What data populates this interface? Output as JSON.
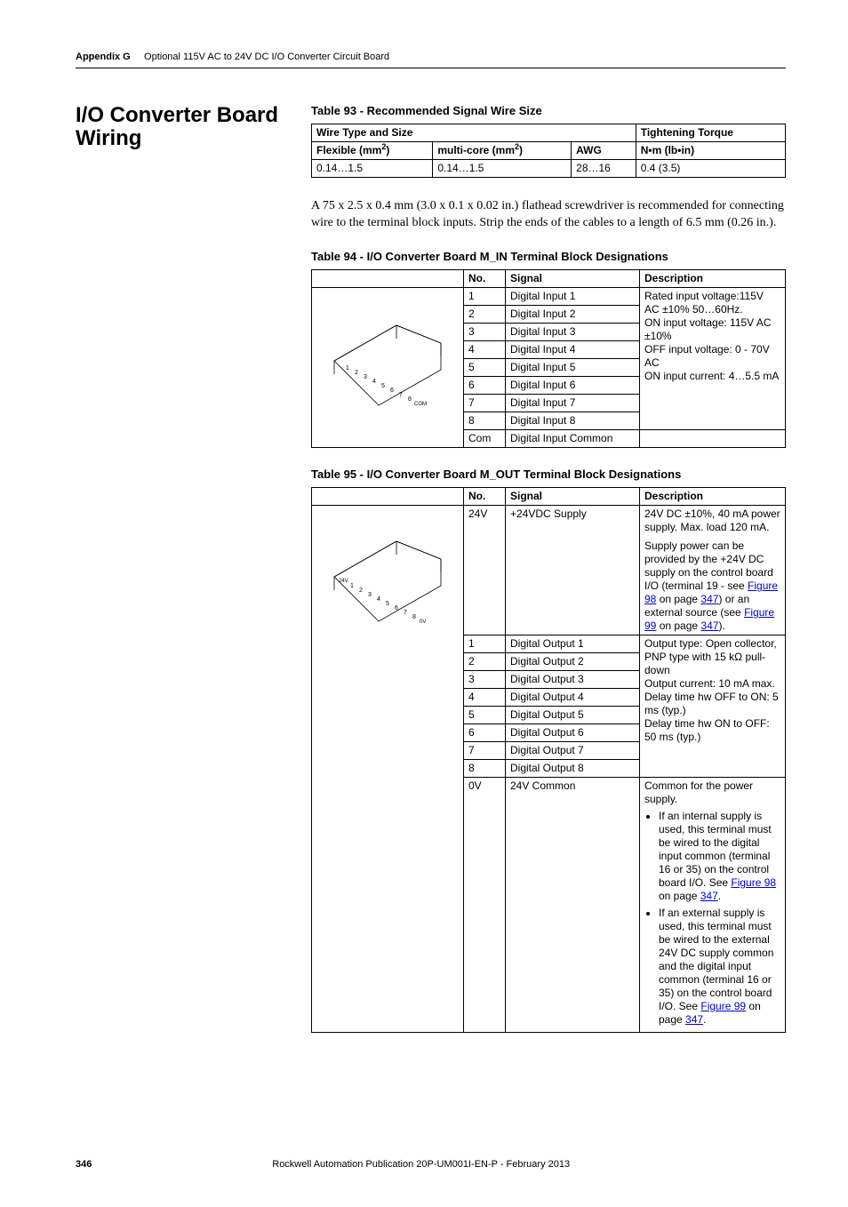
{
  "header": {
    "appendix": "Appendix G",
    "title": "Optional 115V AC to 24V DC I/O Converter Circuit Board"
  },
  "section_title": "I/O Converter Board Wiring",
  "table93": {
    "caption": "Table 93 - Recommended Signal Wire Size",
    "headers": {
      "wire_type": "Wire Type and Size",
      "flex": "Flexible (mm",
      "flex_sup": "2",
      "flex_close": ")",
      "multi": "multi-core (mm",
      "multi_sup": "2",
      "multi_close": ")",
      "awg": "AWG",
      "torque": "Tightening Torque",
      "torque_unit": "N•m (lb•in)"
    },
    "row": {
      "flex": "0.14…1.5",
      "multi": "0.14…1.5",
      "awg": "28…16",
      "torque": "0.4 (3.5)"
    }
  },
  "body_paragraph": "A 75 x 2.5 x 0.4 mm (3.0 x 0.1 x 0.02 in.) flathead screwdriver is recommended for connecting wire to the terminal block inputs. Strip the ends of the cables to a length of 6.5 mm (0.26 in.).",
  "table94": {
    "caption": "Table 94 - I/O Converter Board M_IN Terminal Block Designations",
    "headers": {
      "no": "No.",
      "signal": "Signal",
      "desc": "Description"
    },
    "rows": [
      {
        "no": "1",
        "signal": "Digital Input 1"
      },
      {
        "no": "2",
        "signal": "Digital Input 2"
      },
      {
        "no": "3",
        "signal": "Digital Input 3"
      },
      {
        "no": "4",
        "signal": "Digital Input 4"
      },
      {
        "no": "5",
        "signal": "Digital Input 5"
      },
      {
        "no": "6",
        "signal": "Digital Input 6"
      },
      {
        "no": "7",
        "signal": "Digital Input 7"
      },
      {
        "no": "8",
        "signal": "Digital Input 8"
      },
      {
        "no": "Com",
        "signal": "Digital Input Common"
      }
    ],
    "desc_lines": [
      "Rated input voltage:115V AC ±10% 50…60Hz.",
      "ON input voltage: 115V AC ±10%",
      "OFF input voltage: 0 - 70V AC",
      "ON input current: 4…5.5 mA"
    ]
  },
  "table95": {
    "caption": "Table 95 - I/O Converter Board M_OUT Terminal Block Designations",
    "headers": {
      "no": "No.",
      "signal": "Signal",
      "desc": "Description"
    },
    "row24v": {
      "no": "24V",
      "signal": "+24VDC Supply",
      "desc_l1": "24V DC ±10%, 40 mA power supply. Max. load 120 mA.",
      "desc_l2a": "Supply power can be provided by the +24V DC supply on the control board I/O (terminal 19 - see ",
      "desc_link1": "Figure 98",
      "desc_l2b": " on page ",
      "desc_link1p": "347",
      "desc_l2c": ") or an external source (see ",
      "desc_link2": "Figure 99",
      "desc_l2d": " on page ",
      "desc_link2p": "347",
      "desc_l2e": ")."
    },
    "outputs": [
      {
        "no": "1",
        "signal": "Digital Output 1"
      },
      {
        "no": "2",
        "signal": "Digital Output 2"
      },
      {
        "no": "3",
        "signal": "Digital Output 3"
      },
      {
        "no": "4",
        "signal": "Digital Output 4"
      },
      {
        "no": "5",
        "signal": "Digital Output 5"
      },
      {
        "no": "6",
        "signal": "Digital Output 6"
      },
      {
        "no": "7",
        "signal": "Digital Output 7"
      },
      {
        "no": "8",
        "signal": "Digital Output 8"
      }
    ],
    "outputs_desc": [
      "Output type: Open collector, PNP type with 15 kΩ pull-down",
      "Output current: 10 mA max.",
      "Delay time hw OFF to ON: 5 ms (typ.)",
      "Delay time hw ON to OFF: 50 ms (typ.)"
    ],
    "row0v": {
      "no": "0V",
      "signal": "24V Common",
      "desc_head": "Common for the power supply.",
      "li1a": "If an internal supply is used, this terminal must be wired to the digital input common (terminal 16 or 35) on the control board I/O. See ",
      "li1_link": "Figure 98",
      "li1b": " on page ",
      "li1_linkp": "347",
      "li1c": ".",
      "li2a": "If an external supply is used, this terminal must be wired to the external 24V DC supply common and the digital input common (terminal 16 or 35) on the control board I/O. See ",
      "li2_link": "Figure 99",
      "li2b": " on page ",
      "li2_linkp": "347",
      "li2c": "."
    }
  },
  "footer": {
    "page": "346",
    "pub": "Rockwell Automation Publication 20P-UM001I-EN-P - February 2013"
  }
}
